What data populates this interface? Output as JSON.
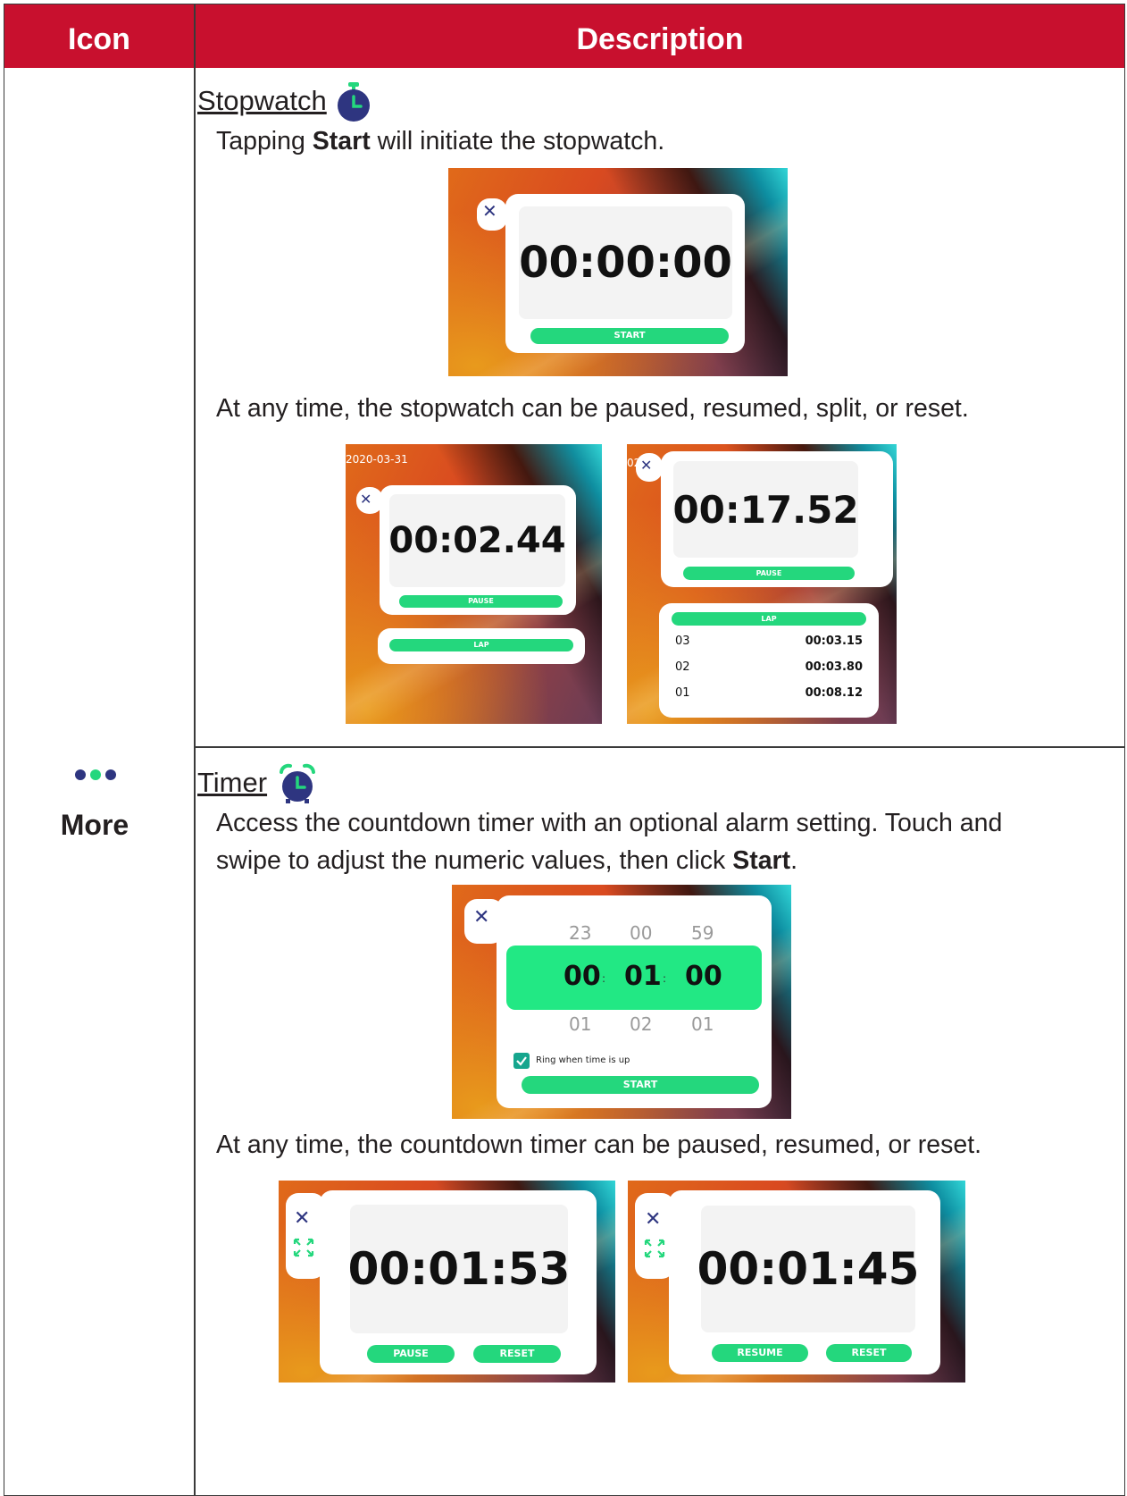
{
  "header": {
    "icon_col": "Icon",
    "desc_col": "Description"
  },
  "icon_cell": {
    "icon": "more-dots-icon",
    "label": "More",
    "dot_colors": [
      "#2e3580",
      "#24d77d",
      "#2e3580"
    ]
  },
  "stopwatch": {
    "title": "Stopwatch",
    "icon": "stopwatch-icon",
    "intro": {
      "before": "Tapping ",
      "bold": "Start",
      "after": " will initiate the stopwatch."
    },
    "shot1": {
      "display": "00:00:00",
      "start_label": "START"
    },
    "caption2": "At any time, the stopwatch can be paused, resumed, split, or reset.",
    "shot2": {
      "date": "2020-03-31",
      "display": "00:02.44",
      "pause_label": "PAUSE",
      "lap_label": "LAP"
    },
    "shot3": {
      "date": "02",
      "display": "00:17.52",
      "pause_label": "PAUSE",
      "lap_label": "LAP",
      "laps": [
        {
          "n": "03",
          "t": "00:03.15"
        },
        {
          "n": "02",
          "t": "00:03.80"
        },
        {
          "n": "01",
          "t": "00:08.12"
        }
      ]
    }
  },
  "timer": {
    "title": "Timer",
    "icon": "alarm-clock-icon",
    "intro": {
      "before": "Access the countdown timer with an optional alarm setting. Touch and swipe to adjust the numeric values, then click ",
      "bold": "Start",
      "after": "."
    },
    "shot1": {
      "above": [
        "23",
        "00",
        "59"
      ],
      "selected": [
        "00",
        "01",
        "00"
      ],
      "below": [
        "01",
        "02",
        "01"
      ],
      "ring_label": "Ring when time is up",
      "ring_checked": true,
      "start_label": "START"
    },
    "caption2": "At any time, the countdown timer can be paused, resumed, or reset.",
    "shot2": {
      "display": "00:01:53",
      "btn1": "PAUSE",
      "btn2": "RESET"
    },
    "shot3": {
      "display": "00:01:45",
      "btn1": "RESUME",
      "btn2": "RESET"
    }
  },
  "colors": {
    "header_red": "#c8102e",
    "accent_green": "#24d77d",
    "navy": "#2e3580"
  }
}
